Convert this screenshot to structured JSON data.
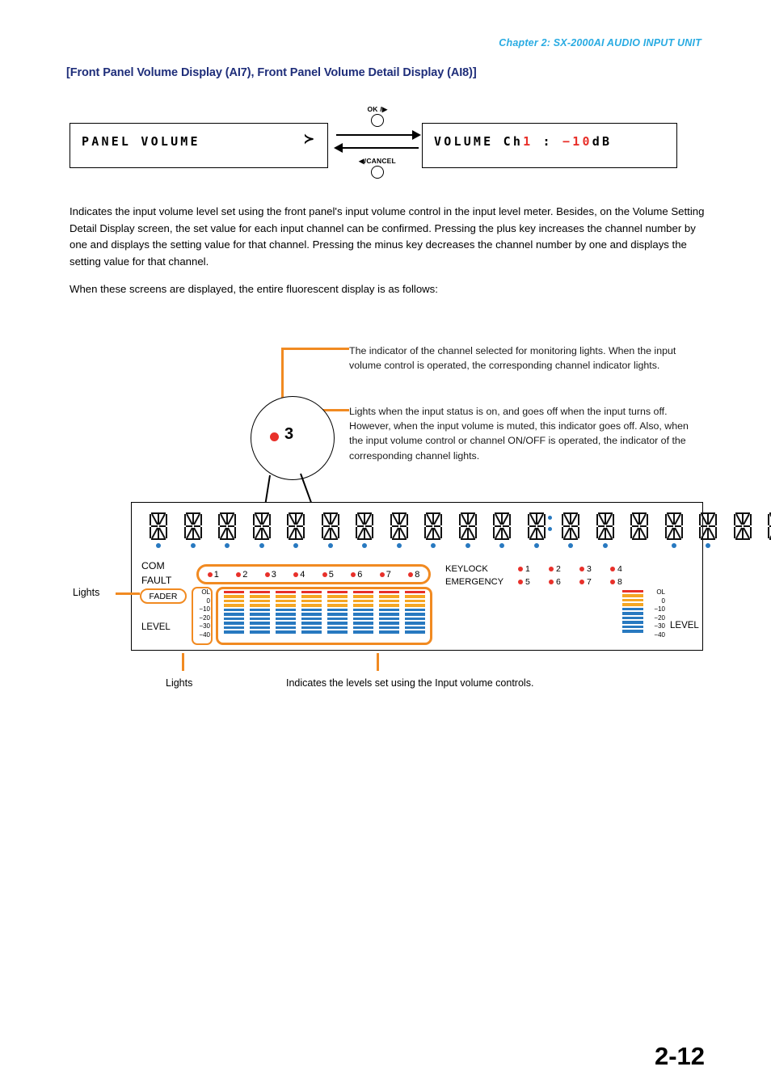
{
  "header": {
    "chapter": "Chapter 2:  SX-2000AI AUDIO INPUT UNIT",
    "section_title": "[Front Panel Volume Display (AI7), Front Panel Volume Detail Display (AI8)]"
  },
  "lcd_diagram": {
    "left_display": {
      "text": "PANEL  VOLUME",
      "arrow_glyph": "≻"
    },
    "right_display": {
      "prefix": "VOLUME  Ch",
      "channel": "1",
      "separator": "  :  ",
      "value": "−10",
      "unit": "dB"
    },
    "keys": {
      "forward_label": "OK /▶",
      "back_label": "◀/CANCEL"
    }
  },
  "body": {
    "paragraph_1": "Indicates the input volume level set using the front panel's input volume control in the input level meter. Besides, on the Volume Setting Detail Display screen, the set value for each input channel can be confirmed. Pressing the plus key increases the channel number by one and displays the setting value for that channel. Pressing the minus key decreases the channel number by one and displays the setting value for that channel.",
    "paragraph_2": "When these screens are displayed, the entire fluorescent display is as follows:"
  },
  "callouts": {
    "callout_1": "The indicator of the channel selected for monitoring lights. When the input volume control is operated, the corresponding channel indicator lights.",
    "callout_2": "Lights when the input status is on, and goes off when the input turns off. However, when the input volume is muted, this indicator goes off. Also, when the input volume control or channel ON/OFF is operated, the indicator of the corresponding channel lights.",
    "magnifier_number": "3"
  },
  "panel": {
    "segment_count": 19,
    "colon_after_index": 11,
    "segment_dots": [
      true,
      true,
      true,
      true,
      true,
      true,
      true,
      true,
      true,
      true,
      true,
      true,
      true,
      true,
      false,
      true,
      true,
      false,
      false
    ],
    "com_label": "COM",
    "fault_label": "FAULT",
    "channel_indicators": [
      "1",
      "2",
      "3",
      "4",
      "5",
      "6",
      "7",
      "8"
    ],
    "keylock_label": "KEYLOCK",
    "emergency_label": "EMERGENCY",
    "keylock_grid": [
      "1",
      "2",
      "3",
      "4",
      "5",
      "6",
      "7",
      "8"
    ],
    "fader_label": "FADER",
    "level_label": "LEVEL",
    "scale_labels": [
      "OL",
      "0",
      "−10",
      "−20",
      "−30",
      "−40"
    ],
    "meter_channels": 8,
    "meter_segments": [
      {
        "color": "red",
        "hex": "#E8302A"
      },
      {
        "color": "orange",
        "hex": "#F5A623"
      },
      {
        "color": "orange",
        "hex": "#F5A623"
      },
      {
        "color": "orange",
        "hex": "#F5A623"
      },
      {
        "color": "blue",
        "hex": "#2879C0"
      },
      {
        "color": "blue",
        "hex": "#2879C0"
      },
      {
        "color": "blue",
        "hex": "#2879C0"
      },
      {
        "color": "blue",
        "hex": "#2879C0"
      },
      {
        "color": "blue",
        "hex": "#2879C0"
      },
      {
        "color": "blue",
        "hex": "#2879C0"
      }
    ],
    "right_level_label": "LEVEL"
  },
  "annotations": {
    "lights_pointer": "Lights",
    "caption_lights": "Lights",
    "caption_levels": "Indicates the levels set using the Input volume controls."
  },
  "footer": {
    "page_number": "2-12"
  },
  "colors": {
    "chapter_blue": "#29ABE2",
    "title_navy": "#1F2E7A",
    "accent_orange": "#F18A21",
    "indicator_red": "#E8302A",
    "meter_blue": "#2879C0",
    "meter_orange": "#F5A623"
  }
}
